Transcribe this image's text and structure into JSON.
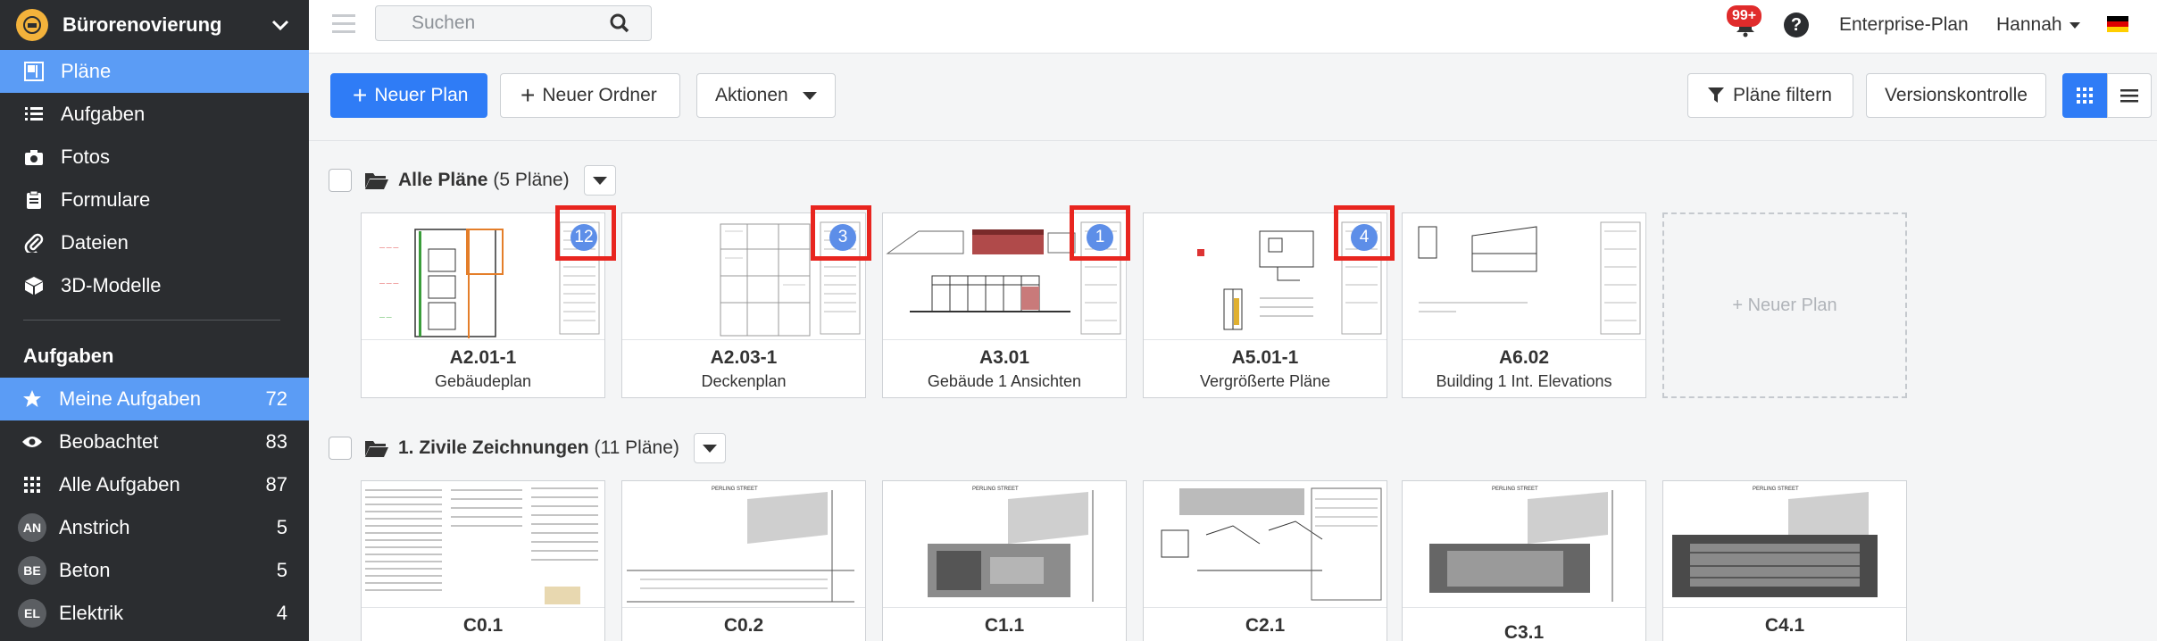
{
  "project": {
    "title": "Bürorenovierung"
  },
  "nav": {
    "items": [
      {
        "label": "Pläne",
        "icon": "plans-icon",
        "active": true
      },
      {
        "label": "Aufgaben",
        "icon": "list-icon"
      },
      {
        "label": "Fotos",
        "icon": "camera-icon"
      },
      {
        "label": "Formulare",
        "icon": "clipboard-icon"
      },
      {
        "label": "Dateien",
        "icon": "paperclip-icon"
      },
      {
        "label": "3D-Modelle",
        "icon": "cube-icon"
      }
    ]
  },
  "tasks": {
    "heading": "Aufgaben",
    "items": [
      {
        "label": "Meine Aufgaben",
        "count": "72",
        "icon": "star-icon",
        "active": true
      },
      {
        "label": "Beobachtet",
        "count": "83",
        "icon": "eye-icon"
      },
      {
        "label": "Alle Aufgaben",
        "count": "87",
        "icon": "grid-icon"
      },
      {
        "label": "Anstrich",
        "count": "5",
        "badge": "AN"
      },
      {
        "label": "Beton",
        "count": "5",
        "badge": "BE"
      },
      {
        "label": "Elektrik",
        "count": "4",
        "badge": "EL"
      }
    ]
  },
  "topbar": {
    "search_placeholder": "Suchen",
    "notifications": "99+",
    "help": "?",
    "plan": "Enterprise-Plan",
    "user": "Hannah"
  },
  "toolbar": {
    "new_plan": "Neuer Plan",
    "new_folder": "Neuer Ordner",
    "actions": "Aktionen",
    "filter": "Pläne filtern",
    "versions": "Versionskontrolle"
  },
  "folders": [
    {
      "name": "Alle Pläne",
      "count_text": "(5 Pläne)",
      "plans": [
        {
          "code": "A2.01-1",
          "name": "Gebäudeplan",
          "count": "12"
        },
        {
          "code": "A2.03-1",
          "name": "Deckenplan",
          "count": "3"
        },
        {
          "code": "A3.01",
          "name": "Gebäude 1 Ansichten",
          "count": "1"
        },
        {
          "code": "A5.01-1",
          "name": "Vergrößerte Pläne",
          "count": "4"
        },
        {
          "code": "A6.02",
          "name": "Building 1 Int. Elevations",
          "count": ""
        }
      ],
      "new_plan_label": "+ Neuer Plan"
    },
    {
      "name": "1. Zivile Zeichnungen",
      "count_text": "(11 Pläne)",
      "plans": [
        {
          "code": "C0.1"
        },
        {
          "code": "C0.2"
        },
        {
          "code": "C1.1"
        },
        {
          "code": "C2.1"
        },
        {
          "code": "C3.1"
        },
        {
          "code": "C4.1"
        }
      ]
    }
  ],
  "colors": {
    "accent": "#2f7cf6",
    "sidebar": "#2b2d30",
    "active": "#5b9cf5",
    "highlight": "#e8251f",
    "badge": "#5d8ee8"
  }
}
